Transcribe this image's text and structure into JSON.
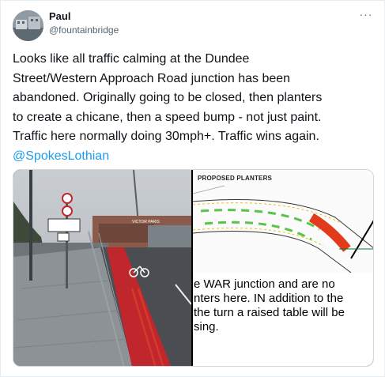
{
  "tweet": {
    "author_name": "Paul",
    "author_handle": "@fountainbridge",
    "more_label": "···",
    "body_lines": [
      "Looks like all traffic calming at the Dundee",
      "Street/Western Approach Road junction has been",
      "abandoned. Originally going to be closed, then planters",
      "to create a chicane, then a speed bump - not just paint.",
      "Traffic here normally doing 30mph+. Traffic wins again."
    ],
    "mention": "@SpokesLothian"
  },
  "media": {
    "photo_sign_text": "VICTOR PARIS",
    "plan_title": "PROPOSED PLANTERS",
    "plan_text_lines": [
      "e WAR junction and are no",
      "nters here. IN addition to the",
      "the turn a raised table will be",
      "sing."
    ]
  },
  "colors": {
    "mention": "#1d9bf0",
    "bike_lane": "#c0272d",
    "plan_highlight": "#e23b1b",
    "plan_planters": "#58c448"
  }
}
